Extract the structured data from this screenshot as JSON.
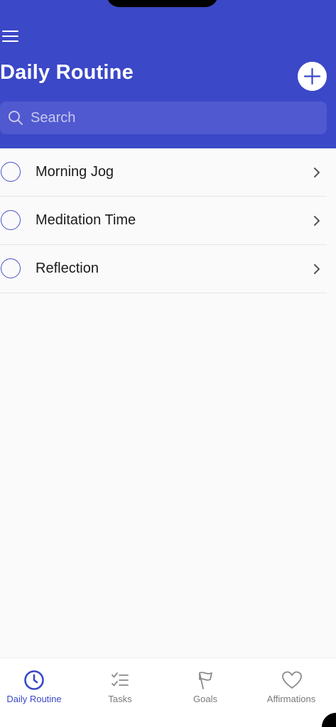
{
  "header": {
    "title": "Daily Routine",
    "menu_icon": "hamburger-menu-icon",
    "add_icon": "plus-icon",
    "background_color": "#3b48c7"
  },
  "search": {
    "placeholder": "Search",
    "icon": "search-icon"
  },
  "routines": [
    {
      "label": "Morning Jog",
      "completed": false
    },
    {
      "label": "Meditation Time",
      "completed": false
    },
    {
      "label": "Reflection",
      "completed": false
    }
  ],
  "tabbar": {
    "accent_color": "#3b48c7",
    "tabs": [
      {
        "label": "Daily Routine",
        "icon": "clock-icon",
        "active": true
      },
      {
        "label": "Tasks",
        "icon": "checklist-icon",
        "active": false
      },
      {
        "label": "Goals",
        "icon": "flag-icon",
        "active": false
      },
      {
        "label": "Affirmations",
        "icon": "heart-icon",
        "active": false
      }
    ]
  }
}
